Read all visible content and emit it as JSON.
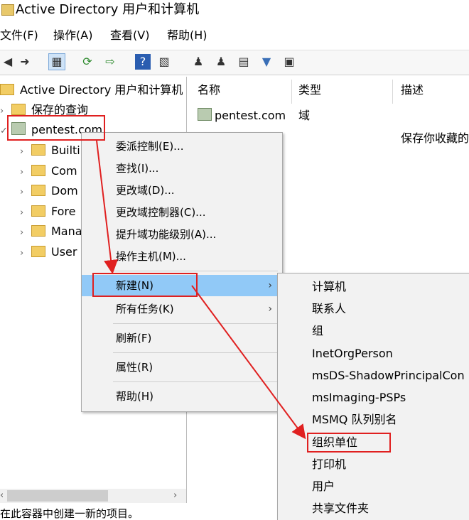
{
  "window": {
    "title": "Active Directory 用户和计算机"
  },
  "menubar": {
    "items": [
      "文件(F)",
      "操作(A)",
      "查看(V)",
      "帮助(H)"
    ]
  },
  "toolbar": {
    "icons": [
      "back-arrow-icon",
      "forward-arrow-icon",
      "console-tree-icon",
      "refresh-icon",
      "export-list-icon",
      "help-icon",
      "action-pane-icon",
      "add-user-icon",
      "add-group-icon",
      "add-ou-icon",
      "filter-icon",
      "find-icon"
    ]
  },
  "tree": {
    "root": "Active Directory 用户和计算机",
    "saved_queries": "保存的查询",
    "domain": "pentest.com",
    "children": [
      "Builti",
      "Com",
      "Dom",
      "Fore",
      "Mana",
      "User"
    ]
  },
  "list": {
    "headers": [
      "名称",
      "类型",
      "描述"
    ],
    "rows": [
      {
        "name": "pentest.com",
        "type": "域",
        "desc": ""
      },
      {
        "name": "",
        "type": "",
        "desc": "保存你收藏的"
      }
    ]
  },
  "context_menu": {
    "items": [
      "委派控制(E)...",
      "查找(I)...",
      "更改域(D)...",
      "更改域控制器(C)...",
      "提升域功能级别(A)...",
      "操作主机(M)...",
      "新建(N)",
      "所有任务(K)",
      "刷新(F)",
      "属性(R)",
      "帮助(H)"
    ],
    "submenu_arrow": "›"
  },
  "submenu": {
    "items": [
      "计算机",
      "联系人",
      "组",
      "InetOrgPerson",
      "msDS-ShadowPrincipalCon",
      "msImaging-PSPs",
      "MSMQ 队列别名",
      "组织单位",
      "打印机",
      "用户",
      "共享文件夹"
    ]
  },
  "status": {
    "text": "在此容器中创建一新的项目。"
  },
  "colors": {
    "highlight": "#91c9f7",
    "annotation_red": "#e02020"
  }
}
